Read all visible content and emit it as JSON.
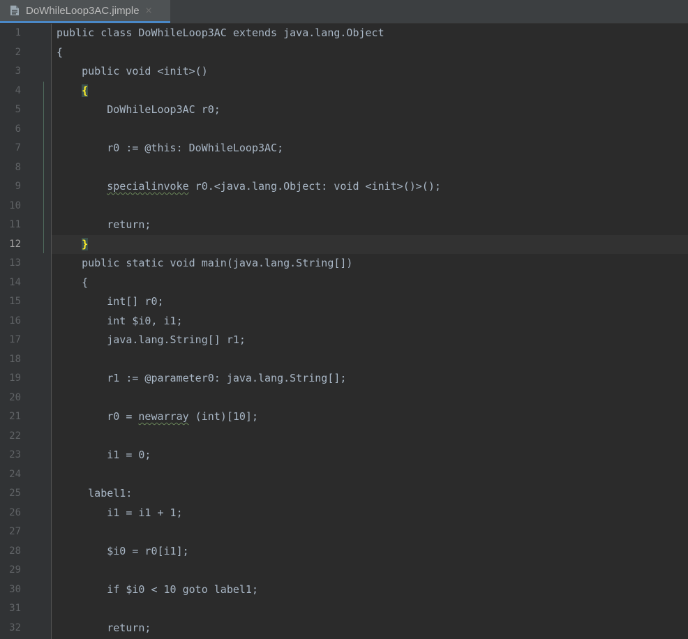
{
  "tab": {
    "filename": "DoWhileLoop3AC.jimple",
    "close_glyph": "×",
    "icon": "file-icon"
  },
  "editor": {
    "current_line": 12,
    "colors": {
      "background": "#2b2b2b",
      "gutter": "#313335",
      "text": "#a9b7c6",
      "line_number": "#606366",
      "current_line": "#323232",
      "brace_highlight": "#ffef28",
      "tab_underline": "#4a88c7"
    },
    "lines": [
      {
        "num": "1",
        "text": "public class DoWhileLoop3AC extends java.lang.Object"
      },
      {
        "num": "2",
        "text": "{"
      },
      {
        "num": "3",
        "text": "    public void <init>()"
      },
      {
        "num": "4",
        "prefix": "    ",
        "brace": "{",
        "suffix": ""
      },
      {
        "num": "5",
        "text": "        DoWhileLoop3AC r0;"
      },
      {
        "num": "6",
        "text": ""
      },
      {
        "num": "7",
        "text": "        r0 := @this: DoWhileLoop3AC;"
      },
      {
        "num": "8",
        "text": ""
      },
      {
        "num": "9",
        "prefix": "        ",
        "squiggle": "specialinvoke",
        "suffix": " r0.<java.lang.Object: void <init>()>();"
      },
      {
        "num": "10",
        "text": ""
      },
      {
        "num": "11",
        "text": "        return;"
      },
      {
        "num": "12",
        "prefix": "    ",
        "brace": "}",
        "suffix": ""
      },
      {
        "num": "13",
        "text": "    public static void main(java.lang.String[])"
      },
      {
        "num": "14",
        "text": "    {"
      },
      {
        "num": "15",
        "text": "        int[] r0;"
      },
      {
        "num": "16",
        "text": "        int $i0, i1;"
      },
      {
        "num": "17",
        "text": "        java.lang.String[] r1;"
      },
      {
        "num": "18",
        "text": ""
      },
      {
        "num": "19",
        "text": "        r1 := @parameter0: java.lang.String[];"
      },
      {
        "num": "20",
        "text": ""
      },
      {
        "num": "21",
        "prefix": "        r0 = ",
        "squiggle": "newarray",
        "suffix": " (int)[10];"
      },
      {
        "num": "22",
        "text": ""
      },
      {
        "num": "23",
        "text": "        i1 = 0;"
      },
      {
        "num": "24",
        "text": ""
      },
      {
        "num": "25",
        "text": "     label1:"
      },
      {
        "num": "26",
        "text": "        i1 = i1 + 1;"
      },
      {
        "num": "27",
        "text": ""
      },
      {
        "num": "28",
        "text": "        $i0 = r0[i1];"
      },
      {
        "num": "29",
        "text": ""
      },
      {
        "num": "30",
        "text": "        if $i0 < 10 goto label1;"
      },
      {
        "num": "31",
        "text": ""
      },
      {
        "num": "32",
        "text": "        return;"
      }
    ]
  }
}
